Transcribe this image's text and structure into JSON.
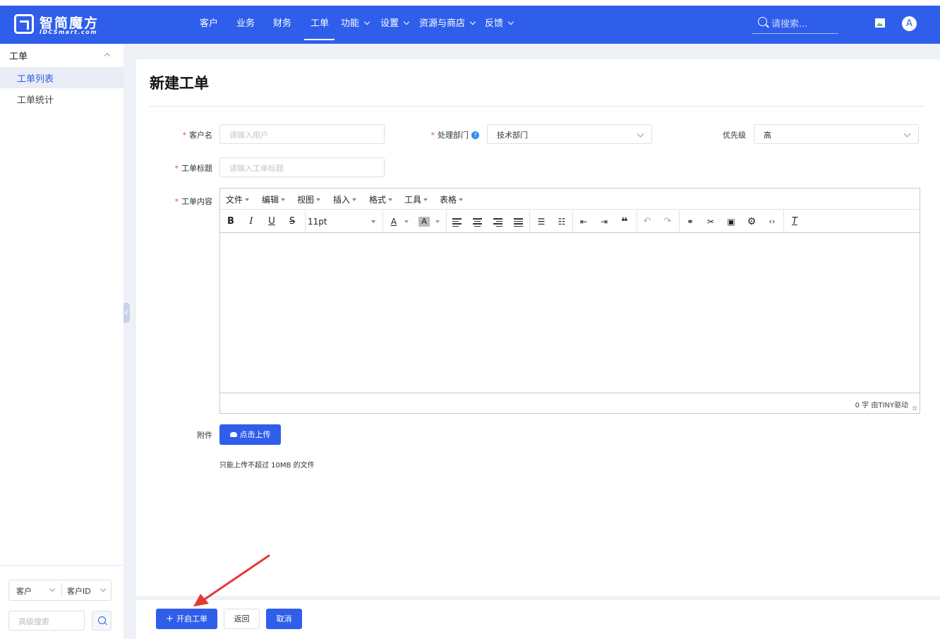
{
  "header": {
    "logo_title": "智简魔方",
    "logo_sub": "IDCSmart.com",
    "nav": [
      {
        "label": "客户",
        "dropdown": false
      },
      {
        "label": "业务",
        "dropdown": false
      },
      {
        "label": "财务",
        "dropdown": false
      },
      {
        "label": "工单",
        "dropdown": false,
        "active": true
      },
      {
        "label": "功能",
        "dropdown": true
      },
      {
        "label": "设置",
        "dropdown": true
      },
      {
        "label": "资源与商店",
        "dropdown": true
      },
      {
        "label": "反馈",
        "dropdown": true
      }
    ],
    "search_placeholder": "请搜索...",
    "avatar_letter": "A",
    "accent_color": "#2f5eea"
  },
  "sidebar": {
    "group_label": "工单",
    "items": [
      {
        "label": "工单列表",
        "active": true
      },
      {
        "label": "工单统计",
        "active": false
      }
    ],
    "filter_type": "客户",
    "filter_field": "客户ID",
    "advanced_search_placeholder": "高级搜索"
  },
  "form": {
    "page_title": "新建工单",
    "customer_label": "客户名",
    "customer_placeholder": "请输入用户",
    "department_label": "处理部门",
    "department_value": "技术部门",
    "priority_label": "优先级",
    "priority_value": "高",
    "subject_label": "工单标题",
    "subject_placeholder": "请输入工单标题",
    "content_label": "工单内容",
    "attachment_label": "附件",
    "upload_button": "点击上传",
    "upload_tip": "只能上传不超过 10MB 的文件"
  },
  "editor": {
    "menus": [
      "文件",
      "编辑",
      "视图",
      "插入",
      "格式",
      "工具",
      "表格"
    ],
    "font_size": "11pt",
    "status": "0 字 由TINY驱动"
  },
  "footer": {
    "submit_label": "开启工单",
    "back_label": "返回",
    "cancel_label": "取消"
  }
}
